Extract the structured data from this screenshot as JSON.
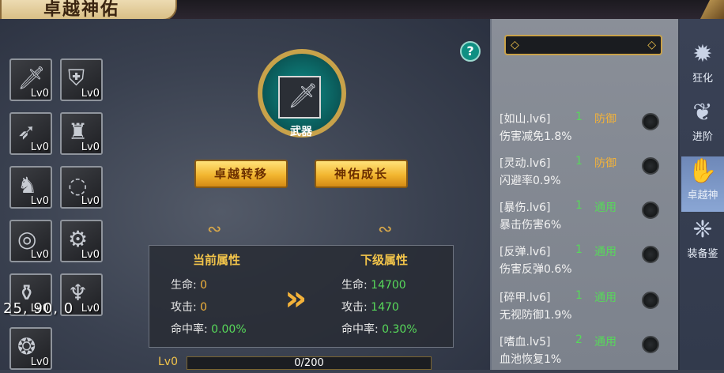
{
  "header": {
    "title": "卓越神佑"
  },
  "equipment_slots": [
    {
      "icon": "sword-icon",
      "level": "Lv0"
    },
    {
      "icon": "armor-icon",
      "level": "Lv0"
    },
    {
      "icon": "bow-icon",
      "level": "Lv0"
    },
    {
      "icon": "chestplate-icon",
      "level": "Lv0"
    },
    {
      "icon": "helmet-icon",
      "level": "Lv0"
    },
    {
      "icon": "necklace-icon",
      "level": "Lv0"
    },
    {
      "icon": "ring-icon",
      "level": "Lv0"
    },
    {
      "icon": "bracer-icon",
      "level": "Lv0"
    },
    {
      "icon": "boots-icon",
      "level": "Lv0"
    },
    {
      "icon": "gloves-icon",
      "level": "Lv0"
    },
    {
      "icon": "amulet-icon",
      "level": "Lv0"
    }
  ],
  "overlay_text": "25,  90,  0",
  "emblem": {
    "label": "武器",
    "icon": "sword-icon"
  },
  "buttons": {
    "transfer": "卓越转移",
    "growth": "神佑成长"
  },
  "attributes": {
    "current_title": "当前属性",
    "next_title": "下级属性",
    "rows": [
      {
        "label": "生命:",
        "current": "0",
        "next": "14700"
      },
      {
        "label": "攻击:",
        "current": "0",
        "next": "1470"
      },
      {
        "label": "命中率:",
        "current": "0.00%",
        "next": "0.30%"
      }
    ]
  },
  "progress": {
    "level_label": "Lv0",
    "text": "0/200",
    "fraction": 0.0
  },
  "list_items": [
    {
      "name": "[如山.lv6]",
      "num": "1",
      "tag": "防御",
      "tag_color": "#f2b23a",
      "desc": "伤害减免1.8%"
    },
    {
      "name": "[灵动.lv6]",
      "num": "1",
      "tag": "防御",
      "tag_color": "#f2b23a",
      "desc": "闪避率0.9%"
    },
    {
      "name": "[暴伤.lv6]",
      "num": "1",
      "tag": "通用",
      "tag_color": "#57d85a",
      "desc": "暴击伤害6%"
    },
    {
      "name": "[反弹.lv6]",
      "num": "1",
      "tag": "通用",
      "tag_color": "#57d85a",
      "desc": "伤害反弹0.6%"
    },
    {
      "name": "[碎甲.lv6]",
      "num": "1",
      "tag": "通用",
      "tag_color": "#57d85a",
      "desc": "无视防御1.9%"
    },
    {
      "name": "[嗜血.lv5]",
      "num": "2",
      "tag": "通用",
      "tag_color": "#57d85a",
      "desc": "血池恢复1%"
    }
  ],
  "side_tabs": [
    {
      "label": "狂化",
      "icon": "flame-icon",
      "active": false
    },
    {
      "label": "进阶",
      "icon": "wing-icon",
      "active": false
    },
    {
      "label": "卓越神",
      "icon": "hand-icon",
      "active": true
    },
    {
      "label": "装备鉴",
      "icon": "crest-icon",
      "active": false
    }
  ],
  "colors": {
    "accent_gold": "#f2c44a",
    "green": "#57d85a",
    "teal": "#0f8f8a"
  }
}
